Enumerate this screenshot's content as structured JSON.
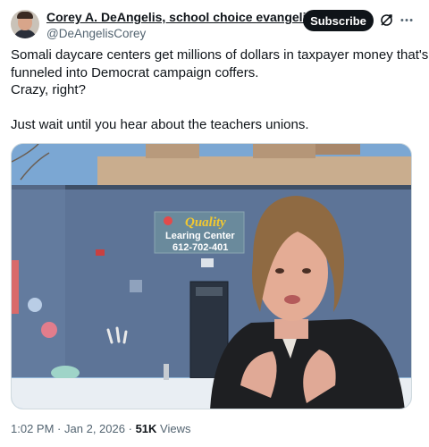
{
  "author": {
    "display_name": "Corey A. DeAngelis, school choice evangelist",
    "handle": "@DeAngelisCorey"
  },
  "actions": {
    "subscribe_label": "Subscribe"
  },
  "tweet": {
    "line1": "Somali daycare centers get millions of dollars in taxpayer money that's",
    "line2": "funneled into Democrat campaign coffers.",
    "line3": "Crazy, right?",
    "line4": "Just wait until you hear about the teachers unions."
  },
  "media": {
    "sign_title": "Quality",
    "sign_subtitle": "Learing Center",
    "sign_phone": "612-702-401"
  },
  "meta": {
    "time": "1:02 PM",
    "separator": "·",
    "date": "Jan 2, 2026",
    "views_count": "51K",
    "views_label": "Views"
  },
  "icons": {
    "verified": "verified-badge-icon",
    "grok": "grok-icon",
    "more": "more-icon"
  },
  "colors": {
    "text": "#0f1419",
    "secondary": "#536471",
    "verified": "#1d9bf0",
    "button": "#0f1419"
  }
}
